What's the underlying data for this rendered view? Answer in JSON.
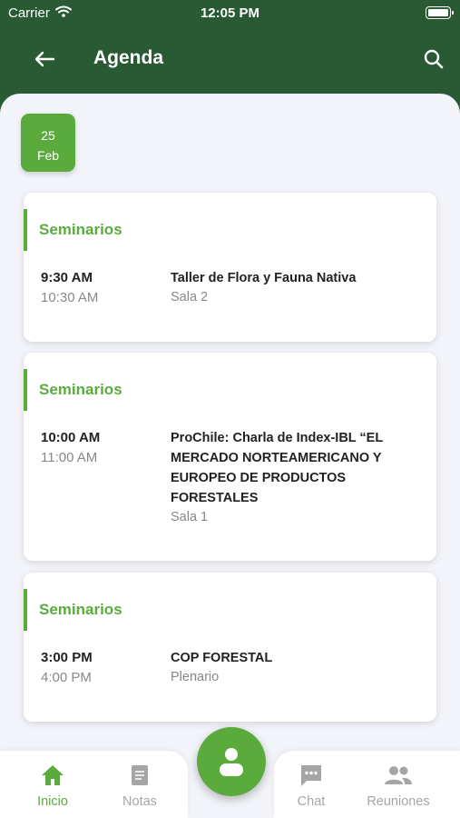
{
  "status_bar": {
    "carrier": "Carrier",
    "time": "12:05 PM"
  },
  "app_bar": {
    "title": "Agenda"
  },
  "date_chip": {
    "day": "25",
    "month": "Feb"
  },
  "events": [
    {
      "category": "Seminarios",
      "start": "9:30 AM",
      "end": "10:30 AM",
      "title_lines": [
        "Taller de Flora y Fauna Nativa"
      ],
      "room": "Sala 2"
    },
    {
      "category": "Seminarios",
      "start": "10:00 AM",
      "end": "11:00 AM",
      "title_lines": [
        "ProChile: Charla de Index-IBL “EL",
        "MERCADO NORTEAMERICANO Y",
        "EUROPEO DE PRODUCTOS",
        "FORESTALES"
      ],
      "room": "Sala 1"
    },
    {
      "category": "Seminarios",
      "start": "3:00 PM",
      "end": "4:00 PM",
      "title_lines": [
        "COP FORESTAL"
      ],
      "room": "Plenario"
    }
  ],
  "bottom_nav": {
    "items": [
      {
        "label": "Inicio",
        "icon": "home-icon",
        "active": true
      },
      {
        "label": "Notas",
        "icon": "notes-icon",
        "active": false
      },
      {
        "label": "Chat",
        "icon": "chat-icon",
        "active": false
      },
      {
        "label": "Reuniones",
        "icon": "people-icon",
        "active": false
      }
    ],
    "fab_icon": "user-icon"
  },
  "colors": {
    "header": "#2a5a33",
    "accent": "#5aab3c",
    "background": "#f2f4f9",
    "inactive": "#a5a5a5"
  }
}
